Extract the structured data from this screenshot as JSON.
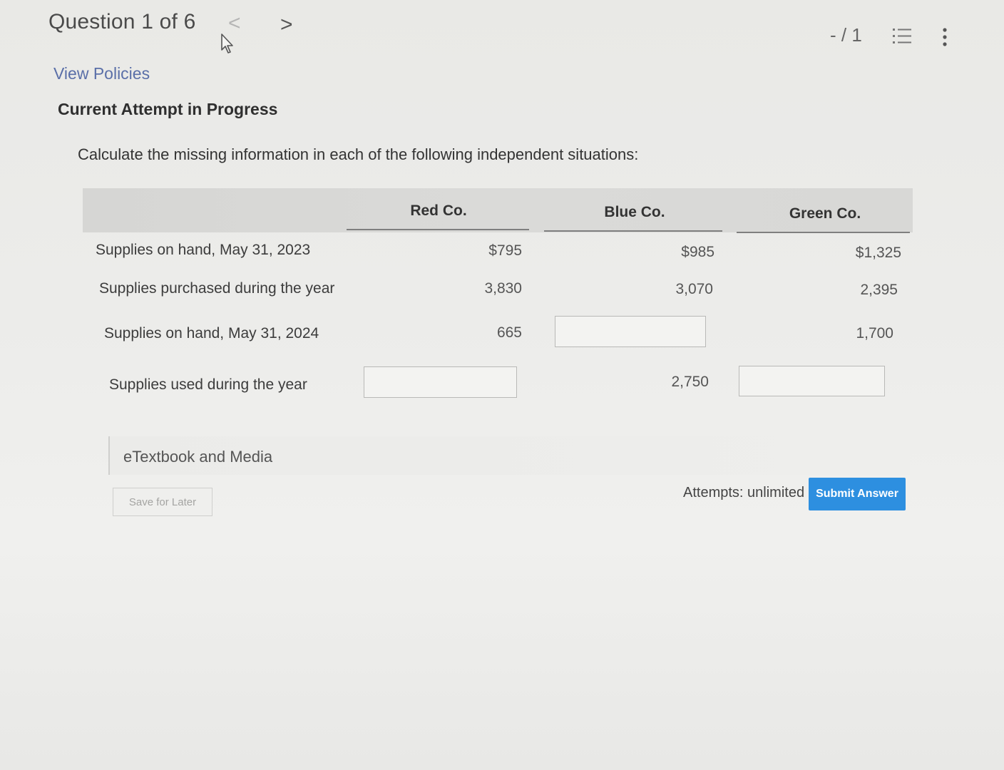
{
  "header": {
    "question_label": "Question 1 of 6",
    "prev_glyph": "<",
    "next_glyph": ">",
    "score": "- / 1",
    "icons": [
      "cursor-icon",
      "list-icon",
      "more-vertical-icon"
    ]
  },
  "links": {
    "view_policies": "View Policies"
  },
  "status": {
    "attempt": "Current Attempt in Progress"
  },
  "instructions": "Calculate the missing information in each of the following independent situations:",
  "table": {
    "columns": [
      "Red Co.",
      "Blue Co.",
      "Green Co."
    ],
    "rows": [
      {
        "label": "Supplies on hand, May 31, 2023",
        "red": "$795",
        "blue": "$985",
        "green": "$1,325"
      },
      {
        "label": "Supplies purchased during the year",
        "red": "3,830",
        "blue": "3,070",
        "green": "2,395"
      },
      {
        "label": "Supplies on hand, May 31, 2024",
        "red": "665",
        "blue": "",
        "green": "1,700"
      },
      {
        "label": "Supplies used during the year",
        "red": "",
        "blue": "2,750",
        "green": ""
      }
    ],
    "inputs": {
      "blue_on_hand_2024": "",
      "red_used": "",
      "green_used": ""
    }
  },
  "footer": {
    "etextbook": "eTextbook and Media",
    "save_for_later": "Save for Later",
    "attempts": "Attempts: unlimited",
    "submit": "Submit Answer"
  },
  "colors": {
    "submit_bg": "#2d8fe0",
    "link": "#5a6fa8"
  }
}
